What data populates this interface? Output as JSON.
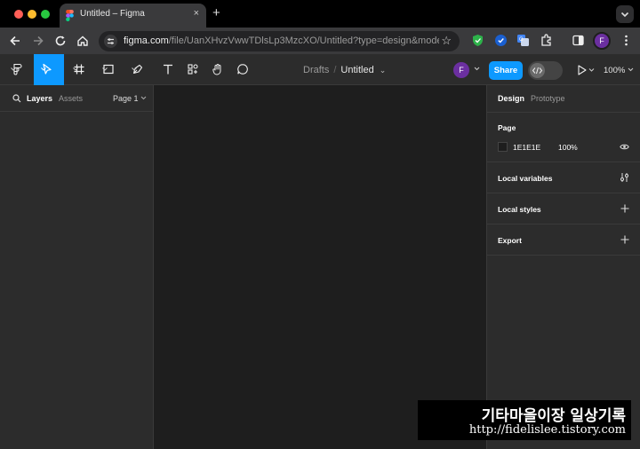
{
  "browser": {
    "tab_title": "Untitled – Figma",
    "tab_close": "×",
    "new_tab": "+",
    "url_host": "figma.com",
    "url_path": "/file/UanXHvzVwwTDlsLp3MzcXO/Untitled?type=design&mode...",
    "star": "☆",
    "profile_initial": "F",
    "traffic_colors": [
      "#ff5f57",
      "#febc2e",
      "#28c840"
    ]
  },
  "toolbar": {
    "breadcrumb_drafts": "Drafts",
    "breadcrumb_sep": "/",
    "file_name": "Untitled",
    "file_chevron": "⌄",
    "avatar_initial": "F",
    "share_label": "Share",
    "zoom": "100%",
    "accent": "#0d99ff"
  },
  "left_panel": {
    "layers_tab": "Layers",
    "assets_tab": "Assets",
    "page_selector": "Page 1"
  },
  "right_panel": {
    "design_tab": "Design",
    "prototype_tab": "Prototype",
    "page_heading": "Page",
    "page_color_hex": "1E1E1E",
    "page_opacity": "100%",
    "local_variables": "Local variables",
    "local_styles": "Local styles",
    "export": "Export"
  },
  "watermark": {
    "title": "기타마을이장 일상기록",
    "url": "http://fidelislee.tistory.com"
  }
}
